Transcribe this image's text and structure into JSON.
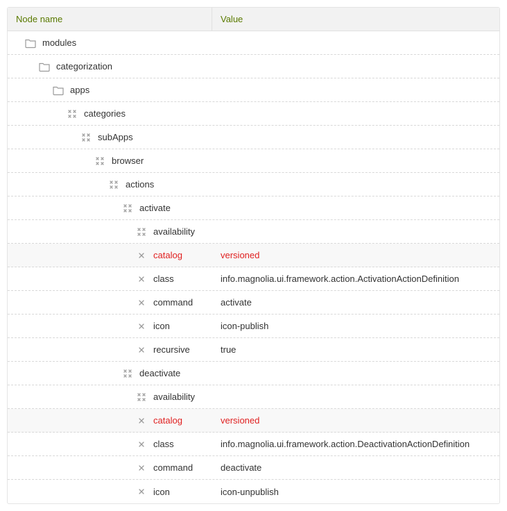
{
  "columns": {
    "name": "Node name",
    "value": "Value"
  },
  "rows": [
    {
      "label": "modules",
      "value": "",
      "depth": 0,
      "icon": "folder",
      "highlight": false
    },
    {
      "label": "categorization",
      "value": "",
      "depth": 1,
      "icon": "folder",
      "highlight": false
    },
    {
      "label": "apps",
      "value": "",
      "depth": 2,
      "icon": "folder",
      "highlight": false
    },
    {
      "label": "categories",
      "value": "",
      "depth": 3,
      "icon": "content",
      "highlight": false
    },
    {
      "label": "subApps",
      "value": "",
      "depth": 4,
      "icon": "content",
      "highlight": false
    },
    {
      "label": "browser",
      "value": "",
      "depth": 5,
      "icon": "content",
      "highlight": false
    },
    {
      "label": "actions",
      "value": "",
      "depth": 6,
      "icon": "content",
      "highlight": false
    },
    {
      "label": "activate",
      "value": "",
      "depth": 7,
      "icon": "content",
      "highlight": false
    },
    {
      "label": "availability",
      "value": "",
      "depth": 8,
      "icon": "content",
      "highlight": false
    },
    {
      "label": "catalog",
      "value": "versioned",
      "depth": 8,
      "icon": "property",
      "highlight": true
    },
    {
      "label": "class",
      "value": "info.magnolia.ui.framework.action.ActivationActionDefinition",
      "depth": 8,
      "icon": "property",
      "highlight": false
    },
    {
      "label": "command",
      "value": "activate",
      "depth": 8,
      "icon": "property",
      "highlight": false
    },
    {
      "label": "icon",
      "value": "icon-publish",
      "depth": 8,
      "icon": "property",
      "highlight": false
    },
    {
      "label": "recursive",
      "value": "true",
      "depth": 8,
      "icon": "property",
      "highlight": false
    },
    {
      "label": "deactivate",
      "value": "",
      "depth": 7,
      "icon": "content",
      "highlight": false
    },
    {
      "label": "availability",
      "value": "",
      "depth": 8,
      "icon": "content",
      "highlight": false
    },
    {
      "label": "catalog",
      "value": "versioned",
      "depth": 8,
      "icon": "property",
      "highlight": true
    },
    {
      "label": "class",
      "value": "info.magnolia.ui.framework.action.DeactivationActionDefinition",
      "depth": 8,
      "icon": "property",
      "highlight": false
    },
    {
      "label": "command",
      "value": "deactivate",
      "depth": 8,
      "icon": "property",
      "highlight": false
    },
    {
      "label": "icon",
      "value": "icon-unpublish",
      "depth": 8,
      "icon": "property",
      "highlight": false
    }
  ]
}
